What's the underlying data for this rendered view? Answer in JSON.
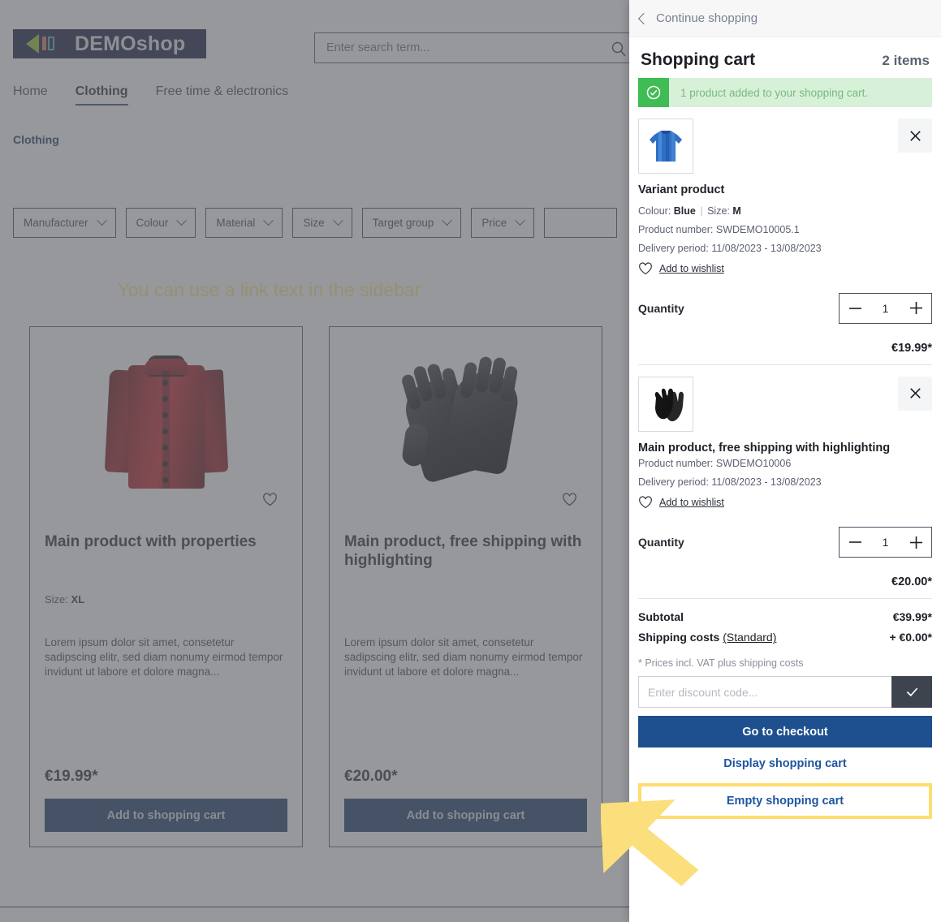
{
  "shop": {
    "logo_text": "DEMOshop",
    "search": {
      "placeholder": "Enter search term...",
      "icon": "search-icon"
    },
    "nav": [
      {
        "label": "Home",
        "active": false
      },
      {
        "label": "Clothing",
        "active": true
      },
      {
        "label": "Free time & electronics",
        "active": false
      }
    ],
    "breadcrumb": "Clothing",
    "filters": [
      {
        "label": "Manufacturer"
      },
      {
        "label": "Colour"
      },
      {
        "label": "Material"
      },
      {
        "label": "Size"
      },
      {
        "label": "Target group"
      },
      {
        "label": "Price"
      }
    ],
    "sidebar_note": "You can use a link text in the sidebar",
    "products": [
      {
        "title": "Main product with properties",
        "property_label": "Size:",
        "property_value": "XL",
        "description": "Lorem ipsum dolor sit amet, consetetur sadipscing elitr, sed diam nonumy eirmod tempor invidunt ut labore et dolore magna...",
        "price": "€19.99*",
        "cart_button": "Add to shopping cart",
        "image": "red-jacket"
      },
      {
        "title": "Main product, free shipping with highlighting",
        "property_label": "",
        "property_value": "",
        "description": "Lorem ipsum dolor sit amet, consetetur sadipscing elitr, sed diam nonumy eirmod tempor invidunt ut labore et dolore magna...",
        "price": "€20.00*",
        "cart_button": "Add to shopping cart",
        "image": "black-gloves"
      }
    ]
  },
  "cart": {
    "back_label": "Continue shopping",
    "title": "Shopping cart",
    "item_count": "2 items",
    "alert": {
      "message": "1 product added to your shopping cart.",
      "icon": "check-circle-icon",
      "bg_color": "#d7f1d9",
      "icon_bg_color": "#40bc54"
    },
    "items": [
      {
        "image": "blue-sweater",
        "name": "Variant product",
        "variant_prefix": "Colour:",
        "variant_colour": "Blue",
        "variant_size_label": "Size:",
        "variant_size": "M",
        "product_number": "Product number: SWDEMO10005.1",
        "delivery_period": "Delivery period: 11/08/2023 - 13/08/2023",
        "wishlist_label": "Add to wishlist",
        "quantity_label": "Quantity",
        "quantity": "1",
        "line_price": "€19.99*",
        "remove_icon": "close-icon"
      },
      {
        "image": "black-gloves",
        "name": "Main product, free shipping with highlighting",
        "variant_prefix": "",
        "variant_colour": "",
        "variant_size_label": "",
        "variant_size": "",
        "product_number": "Product number: SWDEMO10006",
        "delivery_period": "Delivery period: 11/08/2023 - 13/08/2023",
        "wishlist_label": "Add to wishlist",
        "quantity_label": "Quantity",
        "quantity": "1",
        "line_price": "€20.00*",
        "remove_icon": "close-icon"
      }
    ],
    "totals": {
      "subtotal_label": "Subtotal",
      "subtotal_value": "€39.99*",
      "shipping_label": "Shipping costs",
      "shipping_link": "(Standard)",
      "shipping_value": "+ €0.00*",
      "vat_note": "* Prices incl. VAT plus shipping costs"
    },
    "discount": {
      "placeholder": "Enter discount code...",
      "apply_icon": "check-icon"
    },
    "actions": {
      "checkout": "Go to checkout",
      "display_cart": "Display shopping cart",
      "empty_cart": "Empty shopping cart"
    }
  },
  "annotation": {
    "arrow_color": "#fbdf7c",
    "highlight_color": "#ffdc6e",
    "target": "Empty shopping cart"
  }
}
